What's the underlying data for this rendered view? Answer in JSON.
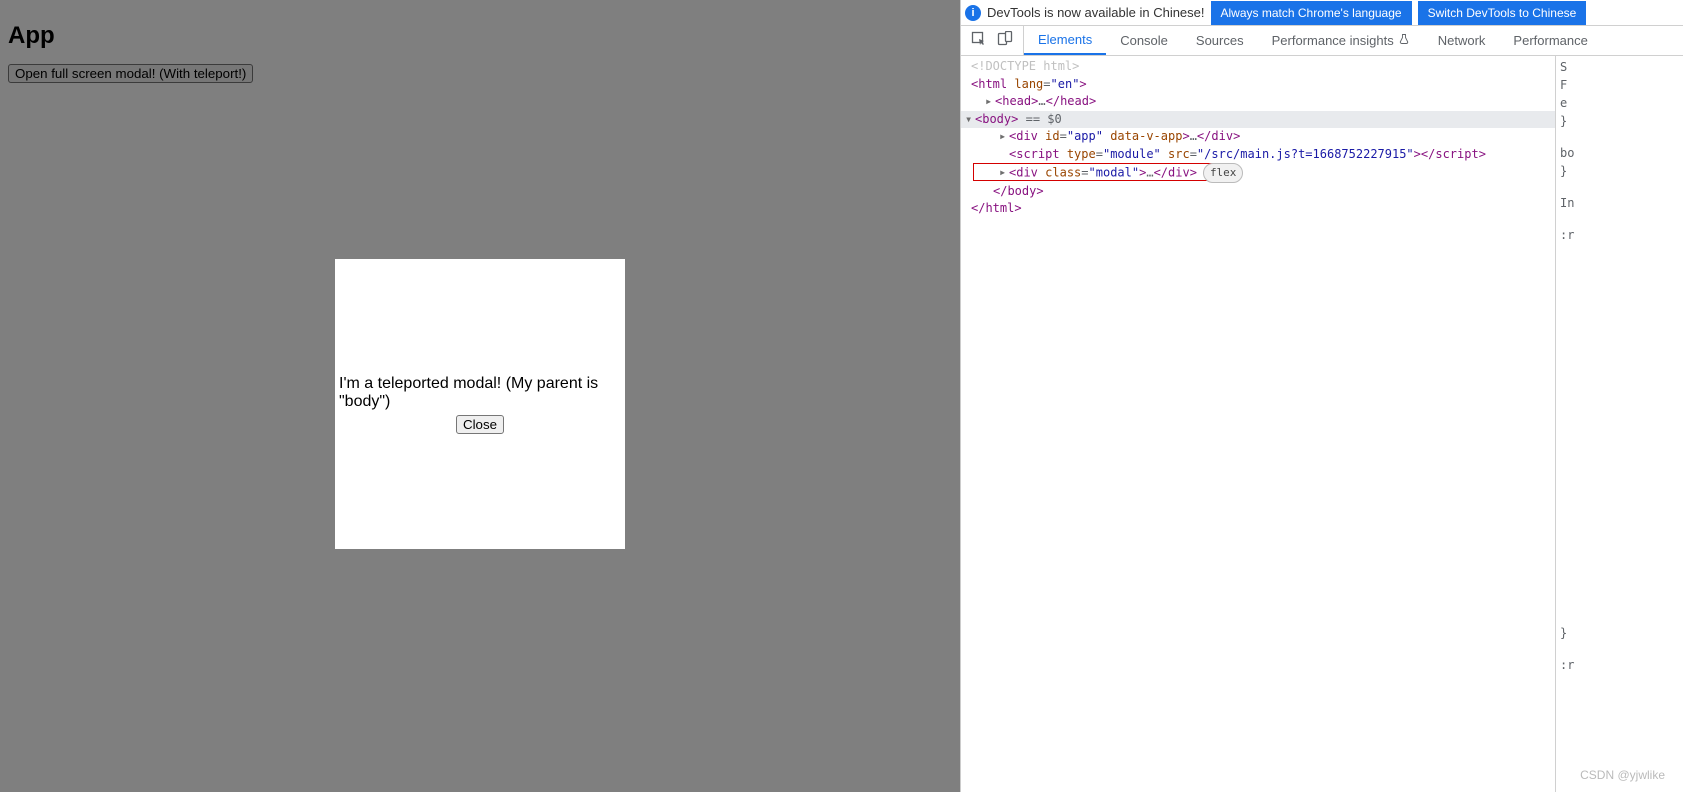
{
  "page": {
    "heading": "App",
    "open_button_label": "Open full screen modal! (With teleport!)",
    "modal_text": "I'm a teleported modal! (My parent is \"body\")",
    "close_button_label": "Close"
  },
  "devtools": {
    "banner": {
      "info_glyph": "i",
      "text": "DevTools is now available in Chinese!",
      "button1": "Always match Chrome's language",
      "button2": "Switch DevTools to Chinese"
    },
    "tabs": {
      "elements": "Elements",
      "console": "Console",
      "sources": "Sources",
      "performance_insights": "Performance insights",
      "network": "Network",
      "performance": "Performance"
    },
    "dom": {
      "doctype": "<!DOCTYPE html>",
      "html_open_pre": "<",
      "html_tag": "html",
      "html_lang_attr": "lang",
      "html_lang_val": "\"en\"",
      "html_close_open": ">",
      "head_collapsed": "<head>…</head>",
      "body_open": "<body>",
      "body_eq": " == $0",
      "app_div": "<div id=\"app\" data-v-app>…</div>",
      "script_line": "<script type=\"module\" src=\"/src/main.js?t=1668752227915\"></scr",
      "script_line2": "ipt>",
      "modal_div": "<div class=\"modal\">…</div>",
      "flex_pill": "flex",
      "body_close": "</body>",
      "html_close": "</html>"
    },
    "styles": {
      "l0": "S",
      "l1": "F",
      "l2": "e",
      "l3": "}",
      "l4": "bo",
      "l5": "}",
      "l6": "In",
      "l7": ":r",
      "l8": "}",
      "l9": ":r"
    }
  },
  "watermark": "CSDN @yjwlike"
}
